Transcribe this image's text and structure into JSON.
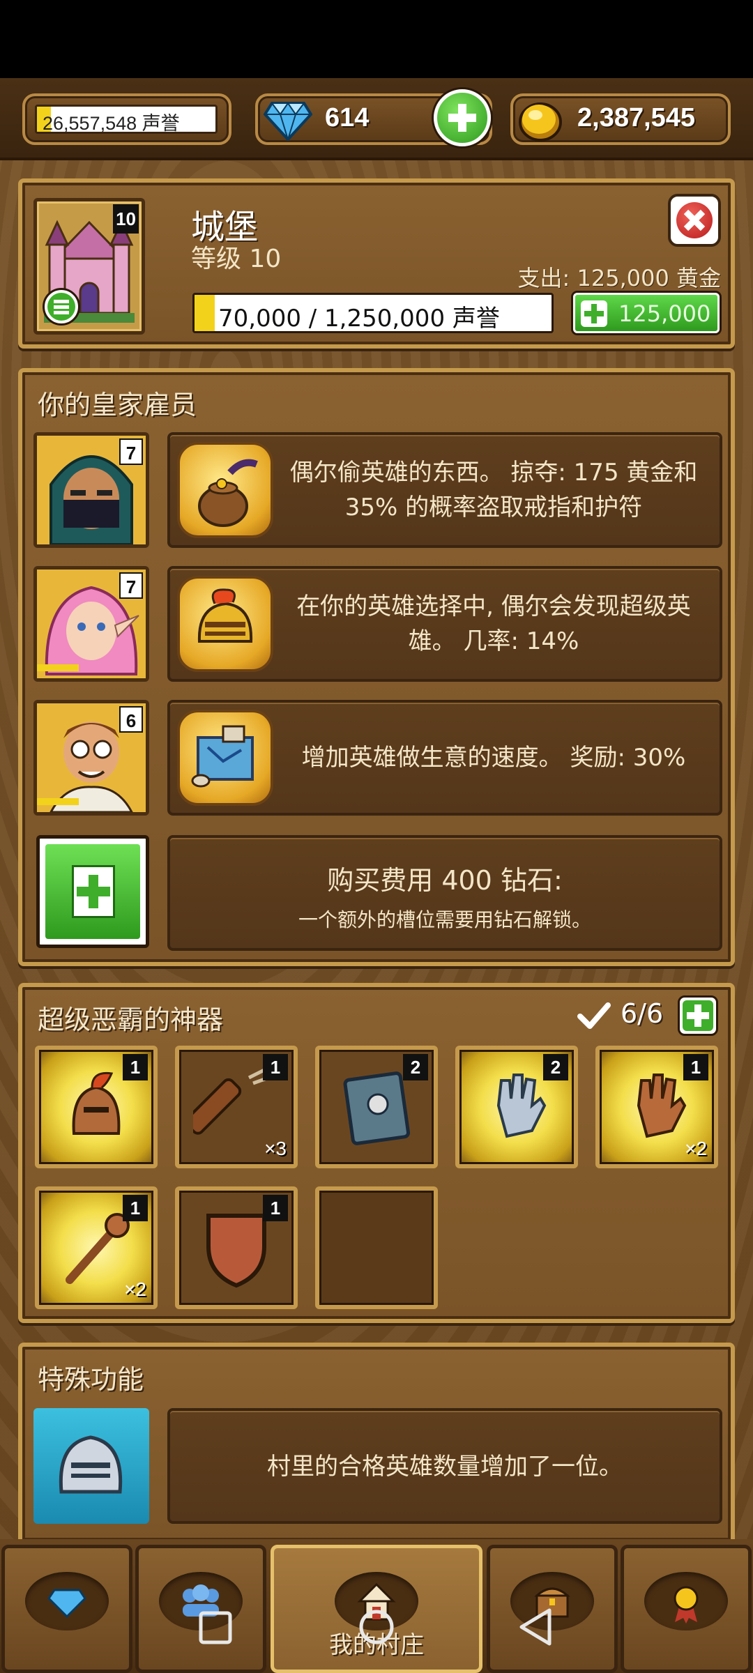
{
  "topbar": {
    "fame_label": "26,557,548 声誉",
    "fame_fill_fraction": 0.08,
    "gems": "614",
    "gold": "2,387,545"
  },
  "building": {
    "name": "城堡",
    "level_label": "等级 10",
    "level_badge": "10",
    "cost_label": "支出: 125,000 黄金",
    "progress_label": "70,000 / 1,250,000 声誉",
    "progress_fraction": 0.056,
    "upgrade_button_label": "125,000"
  },
  "employees": {
    "title": "你的皇家雇员",
    "items": [
      {
        "level": "7",
        "description": "偶尔偷英雄的东西。 掠夺: 175 黄金和 35% 的概率盗取戒指和护符",
        "icon": "thief-loot-icon"
      },
      {
        "level": "7",
        "description": "在你的英雄选择中, 偶尔会发现超级英雄。 几率: 14%",
        "icon": "knight-helmet-icon"
      },
      {
        "level": "6",
        "description": "增加英雄做生意的速度。 奖励: 30%",
        "icon": "map-scroll-icon"
      }
    ],
    "buy_slot": {
      "title": "购买费用 400 钻石:",
      "subtitle": "一个额外的槽位需要用钻石解锁。"
    }
  },
  "artifacts": {
    "title": "超级恶霸的神器",
    "count_label": "6/6",
    "items": [
      {
        "name": "helmet",
        "count": "1",
        "mult": ""
      },
      {
        "name": "arrow-quiver",
        "count": "1",
        "mult": "×3"
      },
      {
        "name": "spell-book",
        "count": "2",
        "mult": ""
      },
      {
        "name": "steel-gauntlet",
        "count": "2",
        "mult": ""
      },
      {
        "name": "leather-gauntlet",
        "count": "1",
        "mult": "×2"
      },
      {
        "name": "mace",
        "count": "1",
        "mult": "×2"
      },
      {
        "name": "shield",
        "count": "1",
        "mult": ""
      }
    ]
  },
  "special": {
    "title": "特殊功能",
    "description": "村里的合格英雄数量增加了一位。"
  },
  "nav": {
    "tabs": [
      {
        "icon": "gem-icon",
        "label": ""
      },
      {
        "icon": "heroes-icon",
        "label": ""
      },
      {
        "icon": "house-icon",
        "label": "我的村庄"
      },
      {
        "icon": "chest-icon",
        "label": ""
      },
      {
        "icon": "medal-icon",
        "label": ""
      }
    ]
  },
  "colors": {
    "wood": "#7a5428",
    "gold_trim": "#c59a4c",
    "green": "#3fae2a",
    "yellow": "#f3d21b"
  }
}
